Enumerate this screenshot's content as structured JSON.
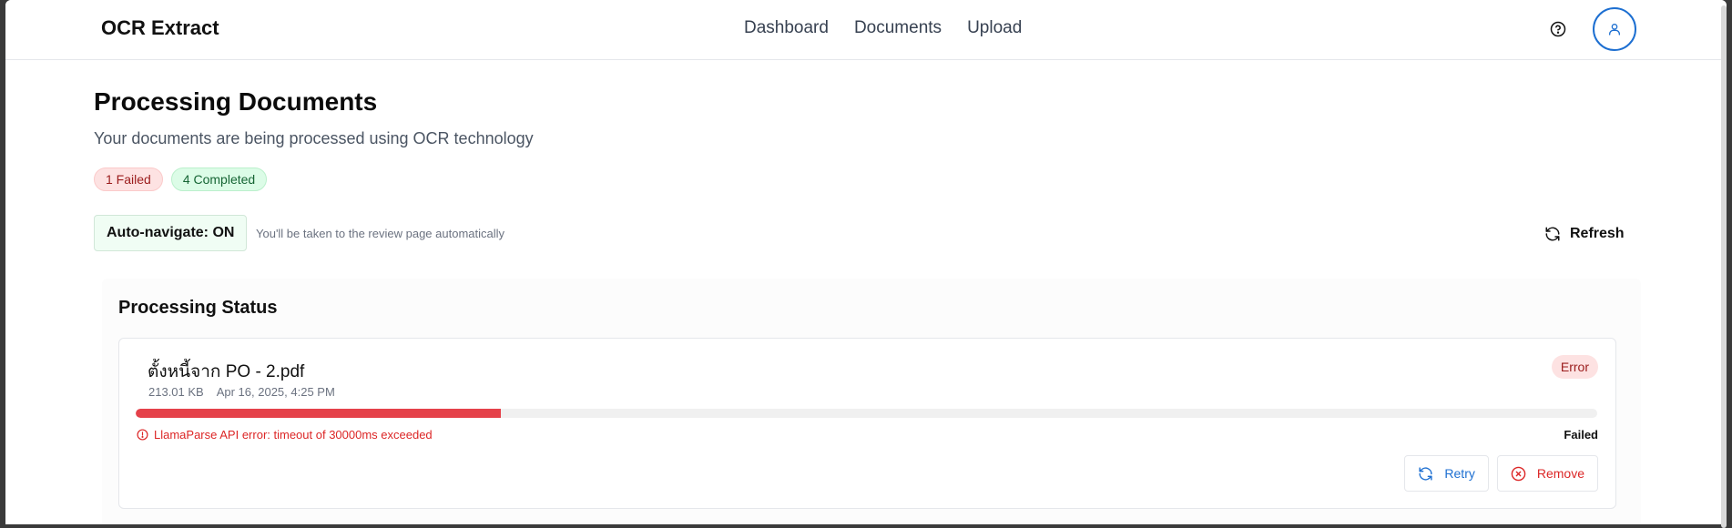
{
  "app": {
    "brand": "OCR Extract",
    "nav": [
      "Dashboard",
      "Documents",
      "Upload"
    ],
    "icons": {
      "help": "help-circle-icon",
      "user": "user-icon",
      "refresh": "refresh-icon"
    },
    "accent": "#1d6fd1"
  },
  "page": {
    "title": "Processing Documents",
    "subtitle": "Your documents are being processed using OCR technology",
    "badges": {
      "failed": "1 Failed",
      "completed": "4 Completed"
    },
    "auto_navigate": "Auto-navigate: ON",
    "auto_navigate_hint": "You'll be taken to the review page automatically",
    "refresh_label": "Refresh"
  },
  "status": {
    "title": "Processing Status",
    "documents": [
      {
        "name": "ตั้งหนี้จาก PO - 2.pdf",
        "size": "213.01 KB",
        "date": "Apr 16, 2025, 4:25 PM",
        "status": "Error",
        "progress_percent": 25,
        "progress_color": "#e5414a",
        "error_message": "LlamaParse API error: timeout of 30000ms exceeded",
        "result_label": "Failed",
        "actions": {
          "retry": "Retry",
          "remove": "Remove"
        }
      }
    ]
  }
}
